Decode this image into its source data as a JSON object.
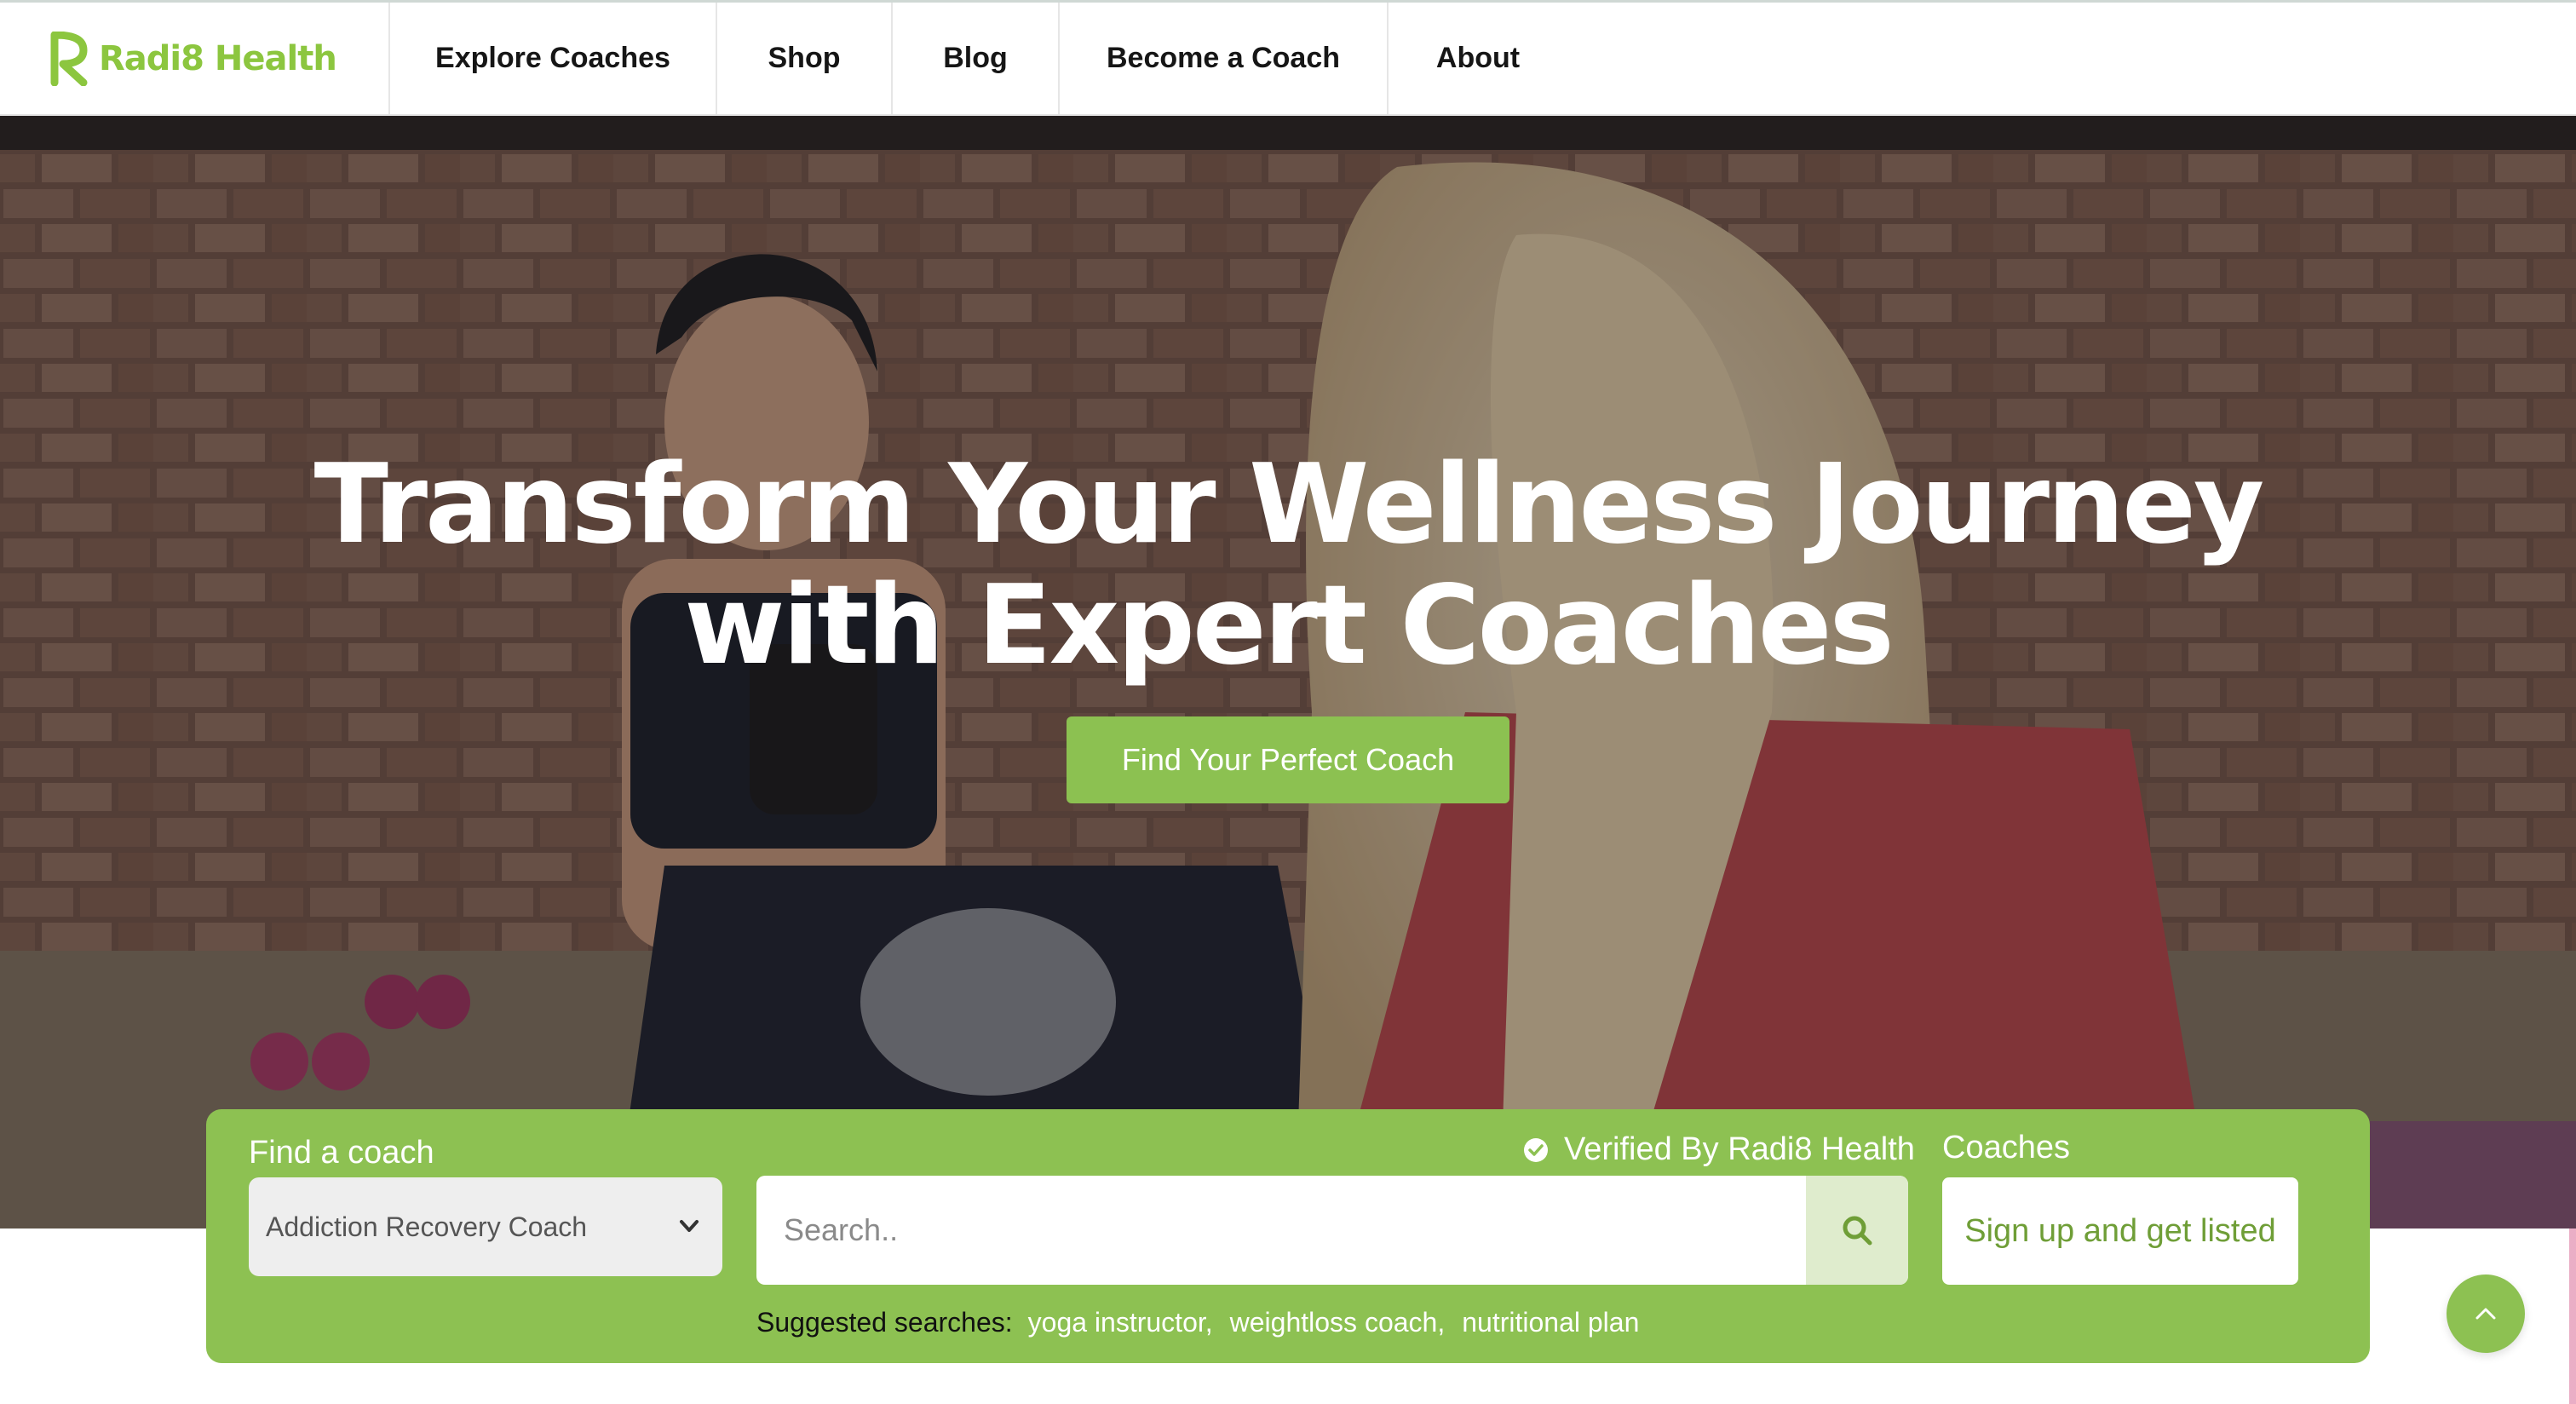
{
  "nav": {
    "brand": "Radi8 Health",
    "items": [
      {
        "label": "Explore Coaches"
      },
      {
        "label": "Shop"
      },
      {
        "label": "Blog"
      },
      {
        "label": "Become a Coach"
      },
      {
        "label": "About"
      }
    ]
  },
  "hero": {
    "title_line1": "Transform Your Wellness Journey",
    "title_line2": "with Expert Coaches",
    "cta_label": "Find Your Perfect Coach"
  },
  "search_panel": {
    "find_label": "Find a coach",
    "selected_category": "Addiction Recovery Coach",
    "verified_text": "Verified By Radi8 Health",
    "search_placeholder": "Search..",
    "coaches_label": "Coaches",
    "signup_label": "Sign up and get listed",
    "suggested_label": "Suggested searches:",
    "suggestions": [
      "yoga instructor,",
      "weightloss coach,",
      "nutritional plan"
    ]
  },
  "colors": {
    "brand_green": "#8cc63f",
    "panel_green": "#8dc152",
    "signup_text": "#6f9e37"
  },
  "icons": {
    "logo": "radi8-logo-icon",
    "verified": "check-circle-icon",
    "search": "search-icon",
    "select": "chevron-down-icon",
    "scroll_top": "chevron-up-icon"
  }
}
